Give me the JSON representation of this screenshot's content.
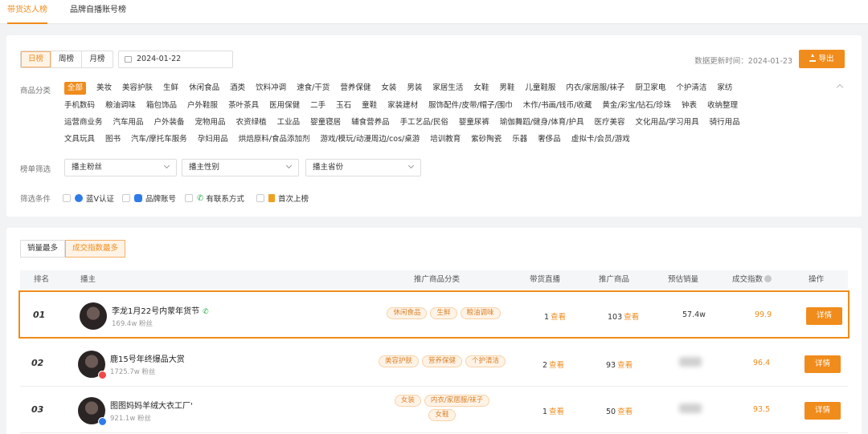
{
  "top_tabs": [
    {
      "label": "带货达人榜",
      "active": true
    },
    {
      "label": "品牌自播账号榜",
      "active": false
    }
  ],
  "period_tabs": [
    {
      "label": "日榜",
      "active": true
    },
    {
      "label": "周榜",
      "active": false
    },
    {
      "label": "月榜",
      "active": false
    }
  ],
  "date_value": "2024-01-22",
  "update_time": "数据更新时间：2024-01-23",
  "export_label": "导出",
  "category": {
    "label": "商品分类",
    "rows": [
      [
        "全部",
        "美妆",
        "美容护肤",
        "生鲜",
        "休闲食品",
        "酒类",
        "饮料冲调",
        "速食/干货",
        "营养保健",
        "女装",
        "男装",
        "家居生活",
        "女鞋",
        "男鞋",
        "儿童鞋服",
        "内衣/家居服/袜子",
        "厨卫家电",
        "个护清洁",
        "家纺"
      ],
      [
        "手机数码",
        "粮油调味",
        "箱包饰品",
        "户外鞋服",
        "茶叶茶具",
        "医用保健",
        "二手",
        "玉石",
        "童鞋",
        "家装建材",
        "服饰配件/皮带/帽子/围巾",
        "木作/书画/钱币/收藏",
        "黄金/彩宝/钻石/珍珠",
        "钟表",
        "收纳整理"
      ],
      [
        "运营商业务",
        "汽车用品",
        "户外装备",
        "宠物用品",
        "农资绿植",
        "工业品",
        "婴童寝居",
        "辅食营养品",
        "手工艺品/民俗",
        "婴童尿裤",
        "瑜伽舞蹈/健身/体育/护具",
        "医疗美容",
        "文化用品/学习用具",
        "骑行用品"
      ],
      [
        "文具玩具",
        "图书",
        "汽车/摩托车服务",
        "孕妇用品",
        "烘焙原料/食品添加剂",
        "游戏/模玩/动漫周边/cos/桌游",
        "培训教育",
        "紫砂陶瓷",
        "乐器",
        "奢侈品",
        "虚拟卡/会员/游戏"
      ]
    ]
  },
  "rank_filter": {
    "label": "榜单筛选",
    "selects": [
      "播主粉丝",
      "播主性别",
      "播主省份"
    ]
  },
  "conditions": {
    "label": "筛选条件",
    "items": [
      {
        "label": "蓝V认证",
        "icon": "blue-v-icon",
        "color": "#2f7be8"
      },
      {
        "label": "品牌账号",
        "icon": "brand-icon",
        "color": "#2f7be8"
      },
      {
        "label": "有联系方式",
        "icon": "phone-icon",
        "color": "#27b148"
      },
      {
        "label": "首次上榜",
        "icon": "first-list-icon",
        "color": "#f0a020"
      }
    ]
  },
  "sort_tabs": [
    {
      "label": "销量最多",
      "active": false
    },
    {
      "label": "成交指数最多",
      "active": true
    }
  ],
  "table": {
    "headers": [
      "排名",
      "播主",
      "推广商品分类",
      "带货直播",
      "推广商品",
      "预估销量",
      "成交指数",
      "操作"
    ],
    "view_label": "查看",
    "detail_label": "详情",
    "rows": [
      {
        "rank": "01",
        "name": "李龙1月22号内蒙年货节",
        "fans": "169.4w 粉丝",
        "has_phone": true,
        "badge": "",
        "tags": [
          "休闲食品",
          "生鲜",
          "粮油调味"
        ],
        "live": "1",
        "products": "103",
        "sales": "57.4w",
        "sales_visible": true,
        "index": "99.9"
      },
      {
        "rank": "02",
        "name": "鹿15号年终爆品大赏",
        "fans": "1725.7w 粉丝",
        "has_phone": false,
        "badge": "#f04848",
        "tags": [
          "美容护肤",
          "营养保健",
          "个护清洁"
        ],
        "live": "2",
        "products": "93",
        "sales": "",
        "sales_visible": false,
        "index": "96.4"
      },
      {
        "rank": "03",
        "name": "图图妈妈羊绒大衣工厂'",
        "fans": "921.1w 粉丝",
        "has_phone": false,
        "badge": "#2f7be8",
        "tags": [
          "女装",
          "内衣/家居服/袜子",
          "女鞋"
        ],
        "live": "1",
        "products": "50",
        "sales": "",
        "sales_visible": false,
        "index": "93.5"
      }
    ]
  }
}
